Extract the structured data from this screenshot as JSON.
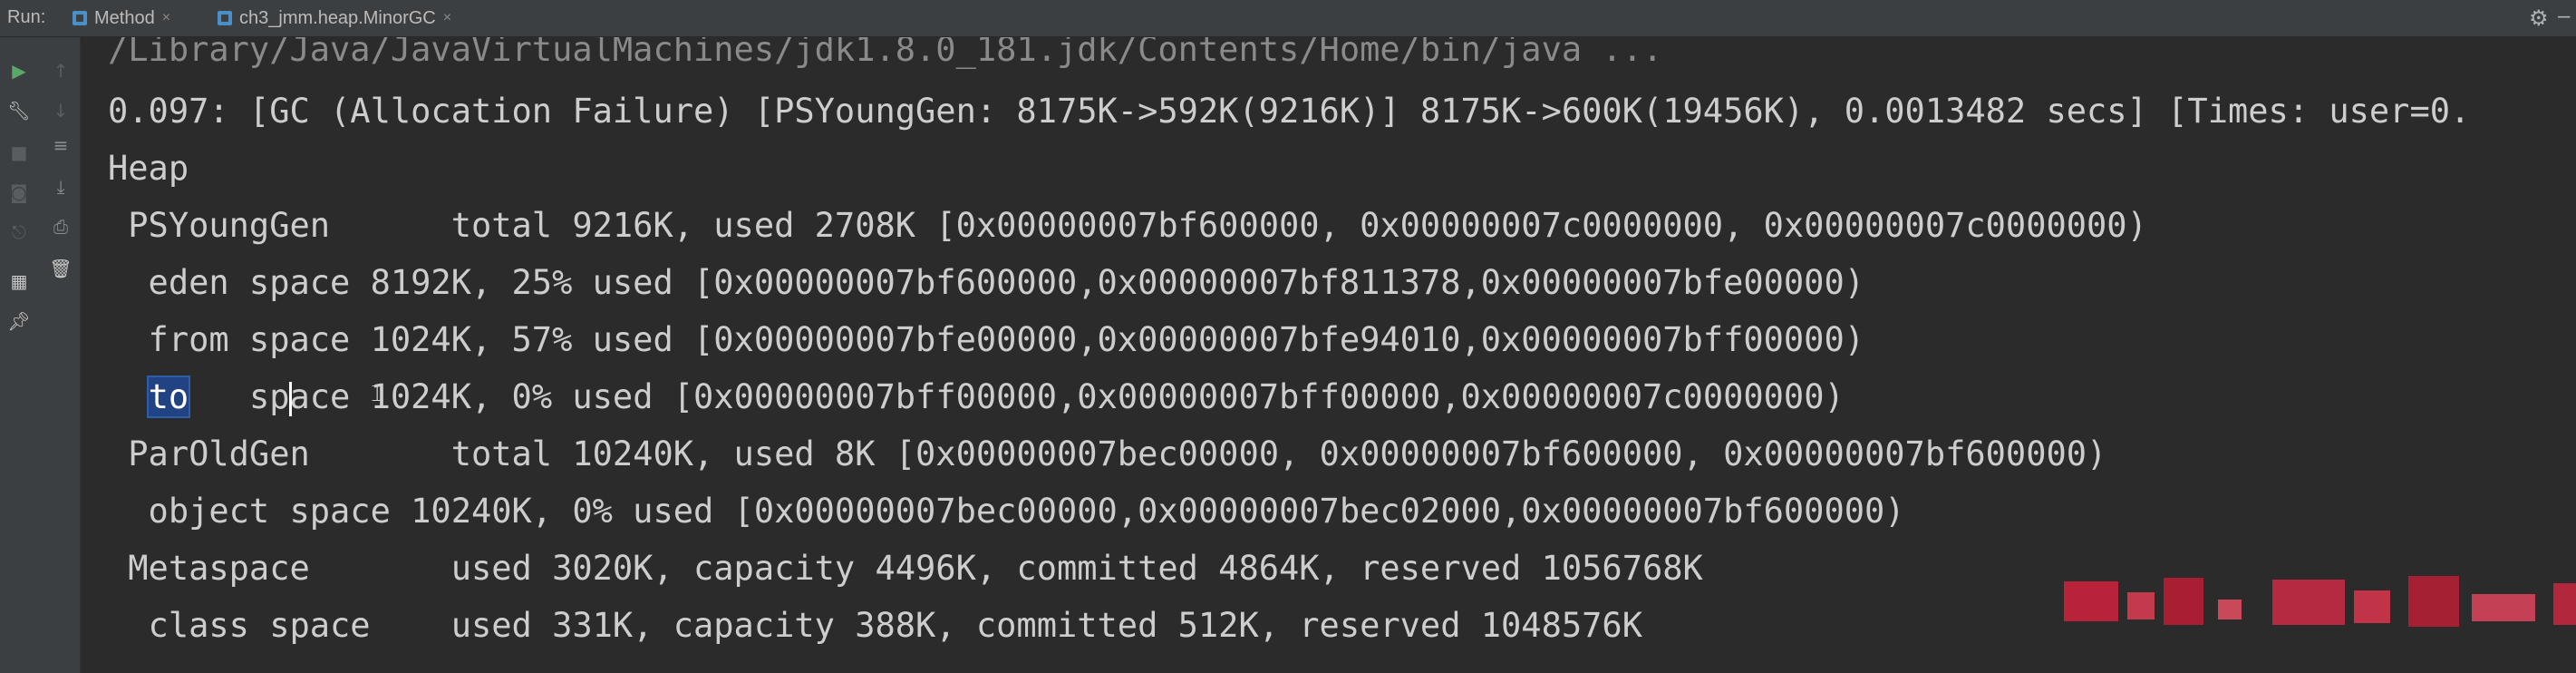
{
  "run_bar": {
    "label": "Run:",
    "tabs": [
      {
        "label": "Method",
        "close": "×"
      },
      {
        "label": "ch3_jmm.heap.MinorGC",
        "close": "×"
      }
    ],
    "settings_icon": "gear-icon",
    "minimize_icon": "minimize-icon"
  },
  "toolstrip": {
    "icons": [
      "run-icon",
      "up-arrow-icon",
      "wrench-icon",
      "down-arrow-icon",
      "stop-icon",
      "soft-wrap-icon",
      "camera-icon",
      "scroll-to-end-icon",
      "exit-icon",
      "print-icon",
      "layout-icon",
      "trash-icon",
      "pin-icon"
    ]
  },
  "console": {
    "lines": [
      {
        "text": "/Library/Java/JavaVirtualMachines/jdk1.8.0_181.jdk/Contents/Home/bin/java ..."
      },
      {
        "text": "0.097: [GC (Allocation Failure) [PSYoungGen: 8175K->592K(9216K)] 8175K->600K(19456K), 0.0013482 secs] [Times: user=0."
      },
      {
        "text": "Heap"
      },
      {
        "text": " PSYoungGen      total 9216K, used 2708K [0x00000007bf600000, 0x00000007c0000000, 0x00000007c0000000)"
      },
      {
        "text": "  eden space 8192K, 25% used [0x00000007bf600000,0x00000007bf811378,0x00000007bfe00000)"
      },
      {
        "text": "  from space 1024K, 57% used [0x00000007bfe00000,0x00000007bfe94010,0x00000007bff00000)"
      },
      {
        "selected": "to",
        "rest": "   space 1024K, 0% used [0x00000007bff00000,0x00000007bff00000,0x00000007c0000000)"
      },
      {
        "text": " ParOldGen       total 10240K, used 8K [0x00000007bec00000, 0x00000007bf600000, 0x00000007bf600000)"
      },
      {
        "text": "  object space 10240K, 0% used [0x00000007bec00000,0x00000007bec02000,0x00000007bf600000)"
      },
      {
        "text": " Metaspace       used 3020K, capacity 4496K, committed 4864K, reserved 1056768K"
      },
      {
        "text": "  class space    used 331K, capacity 388K, committed 512K, reserved 1048576K"
      }
    ]
  },
  "colors": {
    "background": "#2b2b2b",
    "text": "#cdcdcd",
    "selection": "#214283",
    "redaction": "#c0273b"
  }
}
